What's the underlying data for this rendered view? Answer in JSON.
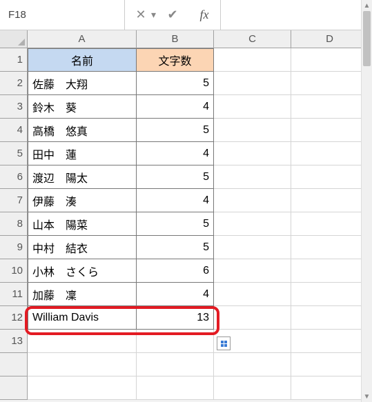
{
  "formula_bar": {
    "name_box": "F18",
    "formula_value": ""
  },
  "columns": [
    "A",
    "B",
    "C",
    "D"
  ],
  "row_numbers": [
    1,
    2,
    3,
    4,
    5,
    6,
    7,
    8,
    9,
    10,
    11,
    12,
    13
  ],
  "headers": {
    "a": "名前",
    "b": "文字数"
  },
  "table": [
    {
      "name": "佐藤　大翔",
      "count": 5
    },
    {
      "name": "鈴木　葵",
      "count": 4
    },
    {
      "name": "高橋　悠真",
      "count": 5
    },
    {
      "name": "田中　蓮",
      "count": 4
    },
    {
      "name": "渡辺　陽太",
      "count": 5
    },
    {
      "name": "伊藤　湊",
      "count": 4
    },
    {
      "name": "山本　陽菜",
      "count": 5
    },
    {
      "name": "中村　結衣",
      "count": 5
    },
    {
      "name": "小林　さくら",
      "count": 6
    },
    {
      "name": "加藤　凜",
      "count": 4
    },
    {
      "name": "William Davis",
      "count": 13
    }
  ],
  "icons": {
    "dropdown": "▾",
    "cancel": "✕",
    "enter": "✔",
    "fx": "fx",
    "scroll_up": "▲",
    "scroll_down": "▼"
  },
  "chart_data": {
    "type": "table",
    "title": "",
    "columns": [
      "名前",
      "文字数"
    ],
    "rows": [
      [
        "佐藤　大翔",
        5
      ],
      [
        "鈴木　葵",
        4
      ],
      [
        "高橋　悠真",
        5
      ],
      [
        "田中　蓮",
        4
      ],
      [
        "渡辺　陽太",
        5
      ],
      [
        "伊藤　湊",
        4
      ],
      [
        "山本　陽菜",
        5
      ],
      [
        "中村　結衣",
        5
      ],
      [
        "小林　さくら",
        6
      ],
      [
        "加藤　凜",
        4
      ],
      [
        "William Davis",
        13
      ]
    ]
  }
}
